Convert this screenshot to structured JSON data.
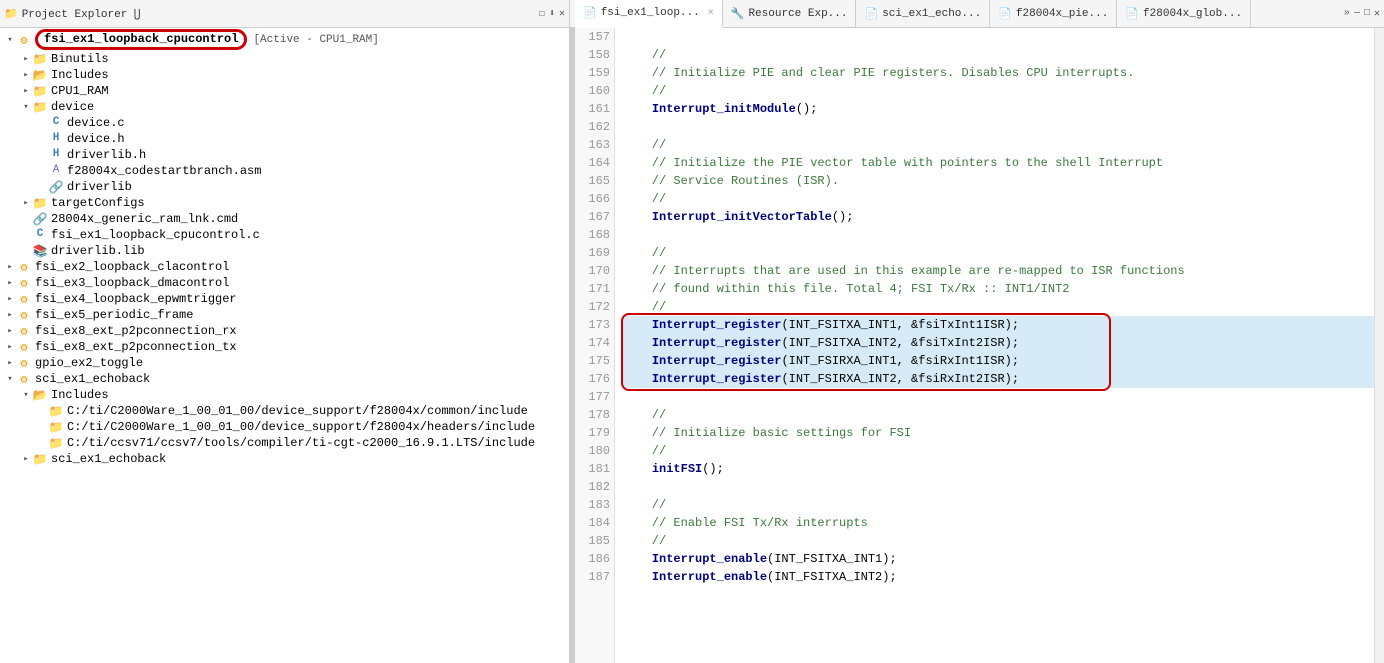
{
  "tabs": [
    {
      "id": "fsi_ex1_loop",
      "label": "fsi_ex1_loop...",
      "active": true,
      "icon": "c-file",
      "closable": true
    },
    {
      "id": "resource_exp",
      "label": "Resource Exp...",
      "active": false,
      "icon": "resource",
      "closable": false
    },
    {
      "id": "sci_ex1_echo",
      "label": "sci_ex1_echo...",
      "active": false,
      "icon": "c-file",
      "closable": false
    },
    {
      "id": "f28004x_pie",
      "label": "f28004x_pie...",
      "active": false,
      "icon": "c-file",
      "closable": false
    },
    {
      "id": "f28004x_glob",
      "label": "f28004x_glob...",
      "active": false,
      "icon": "c-file",
      "closable": false
    }
  ],
  "project_explorer": {
    "title": "Project Explorer ⋃",
    "active_project": "fsi_ex1_loopback_cpucontrol",
    "active_config": "[Active - CPU1_RAM]",
    "tree": [
      {
        "id": "root",
        "label": "fsi_ex1_loopback_cpucontrol",
        "level": 0,
        "type": "project",
        "expanded": true,
        "highlighted": true
      },
      {
        "id": "binutils",
        "label": "Binutils",
        "level": 1,
        "type": "folder",
        "expanded": false
      },
      {
        "id": "includes",
        "label": "Includes",
        "level": 1,
        "type": "includes",
        "expanded": false
      },
      {
        "id": "cpu1ram",
        "label": "CPU1_RAM",
        "level": 1,
        "type": "folder",
        "expanded": false
      },
      {
        "id": "device",
        "label": "device",
        "level": 1,
        "type": "folder",
        "expanded": true
      },
      {
        "id": "device_c",
        "label": "device.c",
        "level": 2,
        "type": "file-c"
      },
      {
        "id": "device_h",
        "label": "device.h",
        "level": 2,
        "type": "file-h"
      },
      {
        "id": "driverlib_h",
        "label": "driverlib.h",
        "level": 2,
        "type": "file-h"
      },
      {
        "id": "f28004x_codestart",
        "label": "f28004x_codestartbranch.asm",
        "level": 2,
        "type": "file-asm"
      },
      {
        "id": "driverlib_folder",
        "label": "driverlib",
        "level": 2,
        "type": "ref-folder"
      },
      {
        "id": "targetconfigs",
        "label": "targetConfigs",
        "level": 1,
        "type": "folder",
        "expanded": false
      },
      {
        "id": "ram_lnk",
        "label": "28004x_generic_ram_lnk.cmd",
        "level": 1,
        "type": "file-cmd"
      },
      {
        "id": "fsi_ex1_c",
        "label": "fsi_ex1_loopback_cpucontrol.c",
        "level": 1,
        "type": "file-c"
      },
      {
        "id": "driverlib_lib",
        "label": "driverlib.lib",
        "level": 1,
        "type": "lib"
      },
      {
        "id": "fsi_ex2",
        "label": "fsi_ex2_loopback_clacontrol",
        "level": 0,
        "type": "project",
        "expanded": false
      },
      {
        "id": "fsi_ex3",
        "label": "fsi_ex3_loopback_dmacontrol",
        "level": 0,
        "type": "project",
        "expanded": false
      },
      {
        "id": "fsi_ex4",
        "label": "fsi_ex4_loopback_epwmtrigger",
        "level": 0,
        "type": "project",
        "expanded": false
      },
      {
        "id": "fsi_ex5",
        "label": "fsi_ex5_periodic_frame",
        "level": 0,
        "type": "project",
        "expanded": false
      },
      {
        "id": "fsi_ex8_rx",
        "label": "fsi_ex8_ext_p2pconnection_rx",
        "level": 0,
        "type": "project",
        "expanded": false
      },
      {
        "id": "fsi_ex8_tx",
        "label": "fsi_ex8_ext_p2pconnection_tx",
        "level": 0,
        "type": "project",
        "expanded": false
      },
      {
        "id": "gpio_ex2",
        "label": "gpio_ex2_toggle",
        "level": 0,
        "type": "project",
        "expanded": false
      },
      {
        "id": "sci_ex1",
        "label": "sci_ex1_echoback",
        "level": 0,
        "type": "project",
        "expanded": true
      },
      {
        "id": "sci_includes",
        "label": "Includes",
        "level": 1,
        "type": "includes",
        "expanded": true
      },
      {
        "id": "sci_inc1",
        "label": "C:/ti/C2000Ware_1_00_01_00/device_support/f28004x/common/include",
        "level": 2,
        "type": "include-path"
      },
      {
        "id": "sci_inc2",
        "label": "C:/ti/C2000Ware_1_00_01_00/device_support/f28004x/headers/include",
        "level": 2,
        "type": "include-path"
      },
      {
        "id": "sci_inc3",
        "label": "C:/ti/ccsv71/ccsv7/tools/compiler/ti-cgt-c2000_16.9.1.LTS/include",
        "level": 2,
        "type": "include-path"
      },
      {
        "id": "sci_ex1_echoback",
        "label": "sci_ex1_echoback",
        "level": 1,
        "type": "folder",
        "expanded": false
      }
    ]
  },
  "code_editor": {
    "lines": [
      {
        "num": 157,
        "text": ""
      },
      {
        "num": 158,
        "text": "    //"
      },
      {
        "num": 159,
        "text": "    // Initialize PIE and clear PIE registers. Disables CPU interrupts."
      },
      {
        "num": 160,
        "text": "    //"
      },
      {
        "num": 161,
        "text": "    Interrupt_initModule();"
      },
      {
        "num": 162,
        "text": ""
      },
      {
        "num": 163,
        "text": "    //"
      },
      {
        "num": 164,
        "text": "    // Initialize the PIE vector table with pointers to the shell Interrupt"
      },
      {
        "num": 165,
        "text": "    // Service Routines (ISR)."
      },
      {
        "num": 166,
        "text": "    //"
      },
      {
        "num": 167,
        "text": "    Interrupt_initVectorTable();"
      },
      {
        "num": 168,
        "text": ""
      },
      {
        "num": 169,
        "text": "    //"
      },
      {
        "num": 170,
        "text": "    // Interrupts that are used in this example are re-mapped to ISR functions"
      },
      {
        "num": 171,
        "text": "    // found within this file. Total 4; FSI Tx/Rx :: INT1/INT2"
      },
      {
        "num": 172,
        "text": "    //"
      },
      {
        "num": 173,
        "text": "    Interrupt_register(INT_FSITXA_INT1, &fsiTxInt1ISR);",
        "highlight": true
      },
      {
        "num": 174,
        "text": "    Interrupt_register(INT_FSITXA_INT2, &fsiTxInt2ISR);",
        "highlight": true
      },
      {
        "num": 175,
        "text": "    Interrupt_register(INT_FSIRXA_INT1, &fsiRxInt1ISR);",
        "highlight": true
      },
      {
        "num": 176,
        "text": "    Interrupt_register(INT_FSIRXA_INT2, &fsiRxInt2ISR);",
        "highlight": true
      },
      {
        "num": 177,
        "text": ""
      },
      {
        "num": 178,
        "text": "    //"
      },
      {
        "num": 179,
        "text": "    // Initialize basic settings for FSI"
      },
      {
        "num": 180,
        "text": "    //"
      },
      {
        "num": 181,
        "text": "    initFSI();"
      },
      {
        "num": 182,
        "text": ""
      },
      {
        "num": 183,
        "text": "    //"
      },
      {
        "num": 184,
        "text": "    // Enable FSI Tx/Rx interrupts"
      },
      {
        "num": 185,
        "text": "    //"
      },
      {
        "num": 186,
        "text": "    Interrupt_enable(INT_FSITXA_INT1);"
      },
      {
        "num": 187,
        "text": "    Interrupt_enable(INT_FSITXA_INT2);"
      }
    ]
  }
}
